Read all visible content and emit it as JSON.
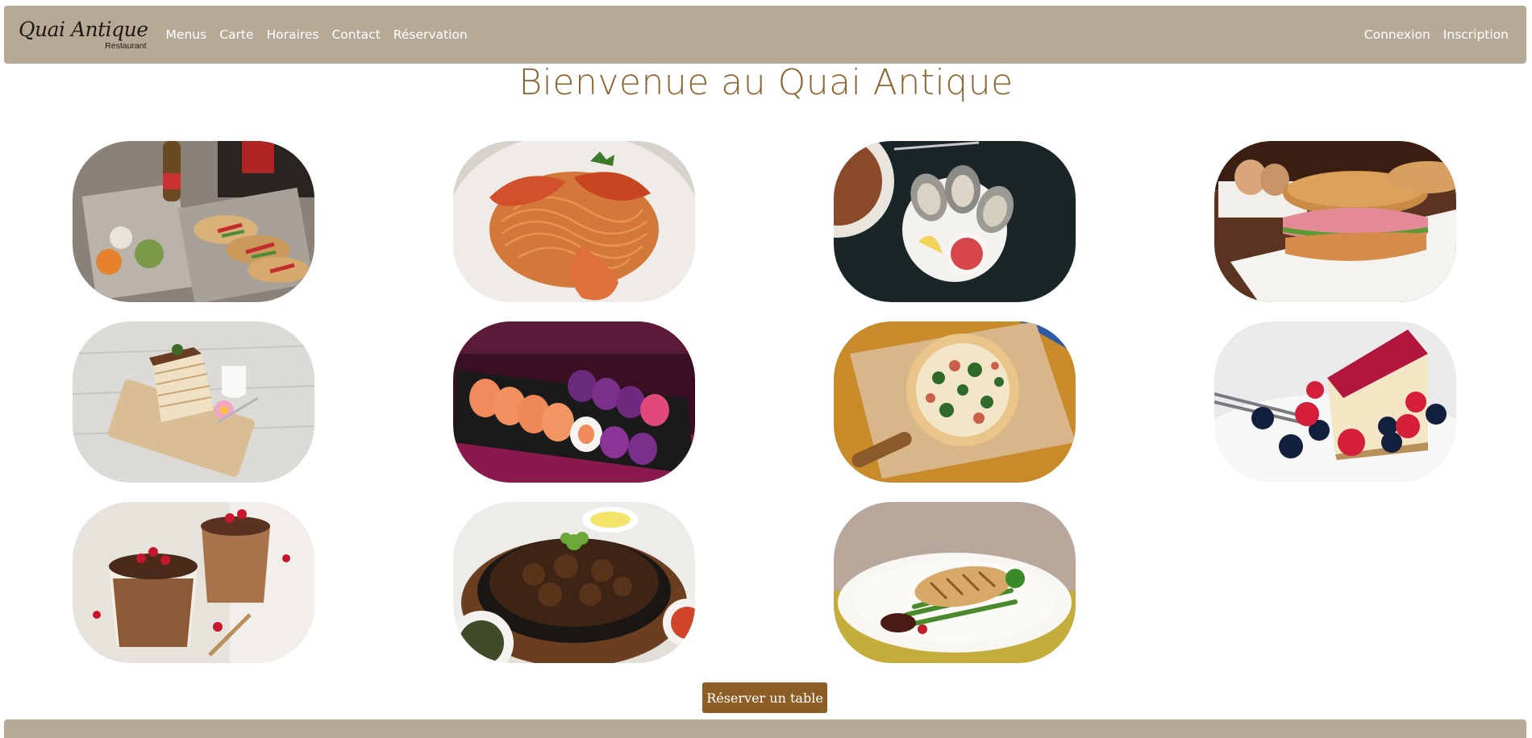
{
  "brand": {
    "name": "Quai Antique",
    "subtitle": "Restaurant"
  },
  "nav": {
    "links": [
      {
        "label": "Menus"
      },
      {
        "label": "Carte"
      },
      {
        "label": "Horaires"
      },
      {
        "label": "Contact"
      },
      {
        "label": "Réservation"
      }
    ],
    "account": [
      {
        "label": "Connexion"
      },
      {
        "label": "Inscription"
      }
    ]
  },
  "page_title": "Bienvenue au Quai Antique",
  "gallery": {
    "dishes": [
      {
        "icon": "tacos-image"
      },
      {
        "icon": "shrimp-pasta-image"
      },
      {
        "icon": "oysters-image"
      },
      {
        "icon": "ham-sandwich-image"
      },
      {
        "icon": "crepe-cake-image"
      },
      {
        "icon": "sushi-image"
      },
      {
        "icon": "pizza-image"
      },
      {
        "icon": "cheesecake-image"
      },
      {
        "icon": "chocolate-mousse-image"
      },
      {
        "icon": "beef-bulgogi-image"
      },
      {
        "icon": "grilled-fish-image"
      }
    ]
  },
  "reserve_button": {
    "label": "Réserver un table"
  },
  "colors": {
    "navbar": "#b6aa96",
    "title": "#8c6531",
    "button": "#8c5e26"
  }
}
